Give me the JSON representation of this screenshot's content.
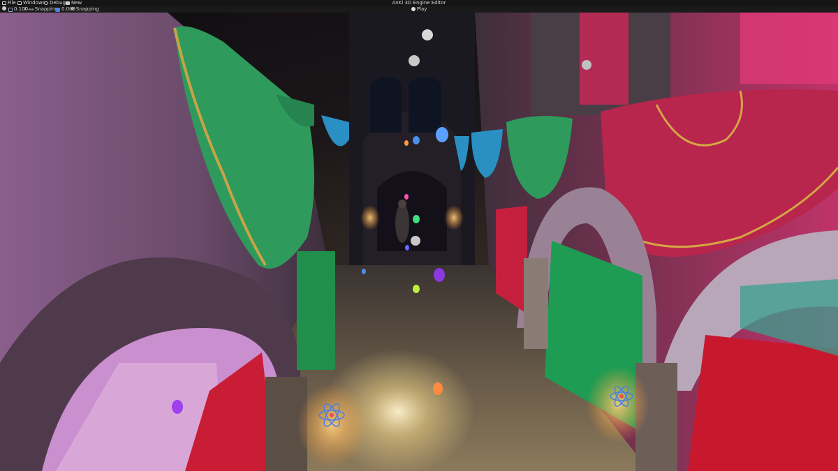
{
  "window": {
    "title": "AnKi 3D Engine Editor"
  },
  "menu": {
    "file": "File",
    "windows": "Windows",
    "debug": "Debug",
    "new": "New"
  },
  "toolbar": {
    "translate_value": "0.100",
    "rotate_snapping": "Snapping",
    "scale_value": "0.000",
    "scale_snapping": "Snapping",
    "play": "Play"
  },
  "icons": {
    "file": "file-icon",
    "windows": "window-icon",
    "debug": "bug-icon",
    "new": "new-icon",
    "gear": "gear-icon",
    "translate": "translate-icon",
    "rotate": "rotate-icon",
    "scale": "scale-icon",
    "snap": "snap-icon",
    "play": "play-icon"
  },
  "colors": {
    "menubar_bg": "#151515",
    "toolbar_bg": "#1a1a1a",
    "text": "#d6d6d6",
    "scale_accent": "#4a86d9"
  }
}
